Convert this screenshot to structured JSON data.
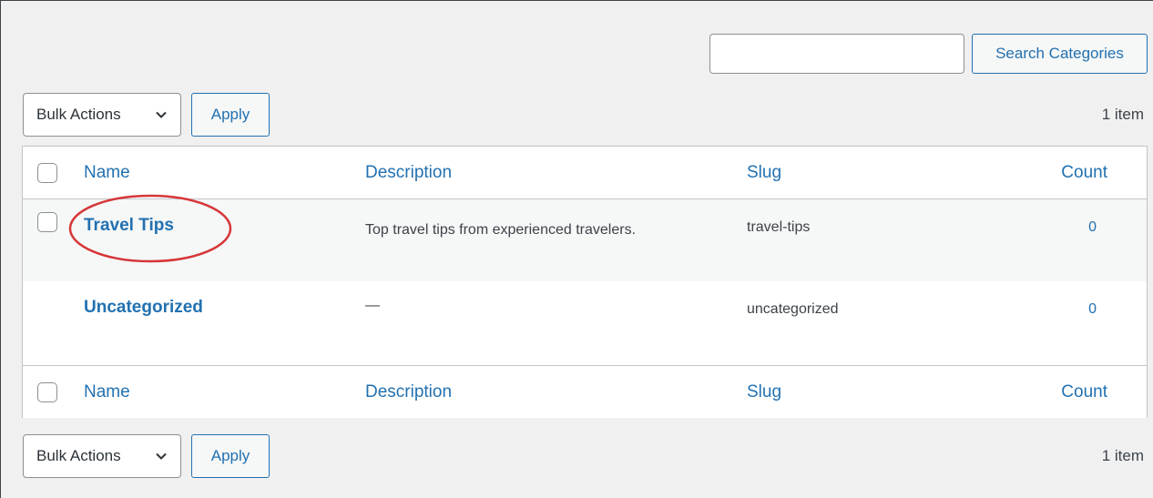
{
  "search": {
    "value": "",
    "placeholder": "",
    "button_label": "Search Categories"
  },
  "top_nav": {
    "bulk_actions_label": "Bulk Actions",
    "apply_label": "Apply",
    "item_count": "1 item"
  },
  "bottom_nav": {
    "bulk_actions_label": "Bulk Actions",
    "apply_label": "Apply",
    "item_count": "1 item"
  },
  "table": {
    "headers": {
      "name": "Name",
      "description": "Description",
      "slug": "Slug",
      "count": "Count"
    },
    "footers": {
      "name": "Name",
      "description": "Description",
      "slug": "Slug",
      "count": "Count"
    },
    "rows": [
      {
        "name": "Travel Tips",
        "description": "Top travel tips from experienced travelers.",
        "slug": "travel-tips",
        "count": "0"
      },
      {
        "name": "Uncategorized",
        "description": "—",
        "slug": "uncategorized",
        "count": "0"
      }
    ]
  },
  "colors": {
    "accent": "#2271b1",
    "annotation": "#d63638",
    "background": "#f0f0f1"
  }
}
